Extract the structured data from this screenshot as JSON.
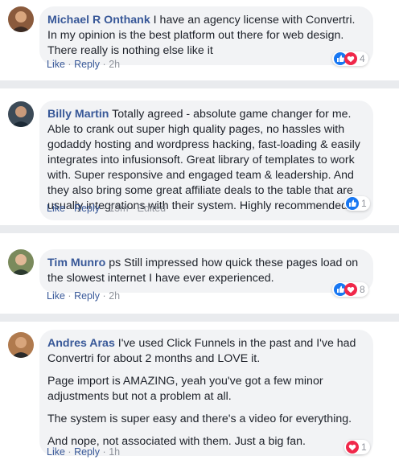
{
  "comments": [
    {
      "author": "Michael R Onthank",
      "paragraphs": [
        "I have an agency license with Convertri. In my opinion is the best platform out there for web design. There really is nothing else like it"
      ],
      "like": "Like",
      "reply": "Reply",
      "time": "2h",
      "edited": "",
      "reactions": [
        "like",
        "love"
      ],
      "reaction_count": "4"
    },
    {
      "author": "Billy Martin",
      "paragraphs": [
        "Totally agreed - absolute game changer for me. Able to crank out super high quality pages, no hassles with godaddy hosting and wordpress hacking, fast-loading & easily integrates into infusionsoft. Great library of templates to work with. Super responsive and engaged team & leadership. And they also bring some great affiliate deals to the table that are usually integrations with their system. Highly recommended"
      ],
      "like": "Like",
      "reply": "Reply",
      "time": "13m",
      "edited": "Edited",
      "reactions": [
        "like"
      ],
      "reaction_count": "1"
    },
    {
      "author": "Tim Munro",
      "paragraphs": [
        "ps Still impressed how quick these pages load on the slowest internet I have ever experienced."
      ],
      "like": "Like",
      "reply": "Reply",
      "time": "2h",
      "edited": "",
      "reactions": [
        "like",
        "love"
      ],
      "reaction_count": "8"
    },
    {
      "author": "Andres Aras",
      "paragraphs": [
        "I've used Click Funnels in the past and I've had Convertri for about 2 months and LOVE it.",
        "Page import is AMAZING, yeah you've got a few minor adjustments but not a problem at all.",
        "The system is super easy and there's a video for everything.",
        "And nope, not associated with them. Just a big fan."
      ],
      "like": "Like",
      "reply": "Reply",
      "time": "1h",
      "edited": "",
      "reactions": [
        "love"
      ],
      "reaction_count": "1"
    }
  ],
  "colors": {
    "link": "#385898",
    "bubble": "#f2f3f5",
    "like": "#1877f2",
    "love": "#f0284a",
    "divider": "#e9ebee"
  }
}
